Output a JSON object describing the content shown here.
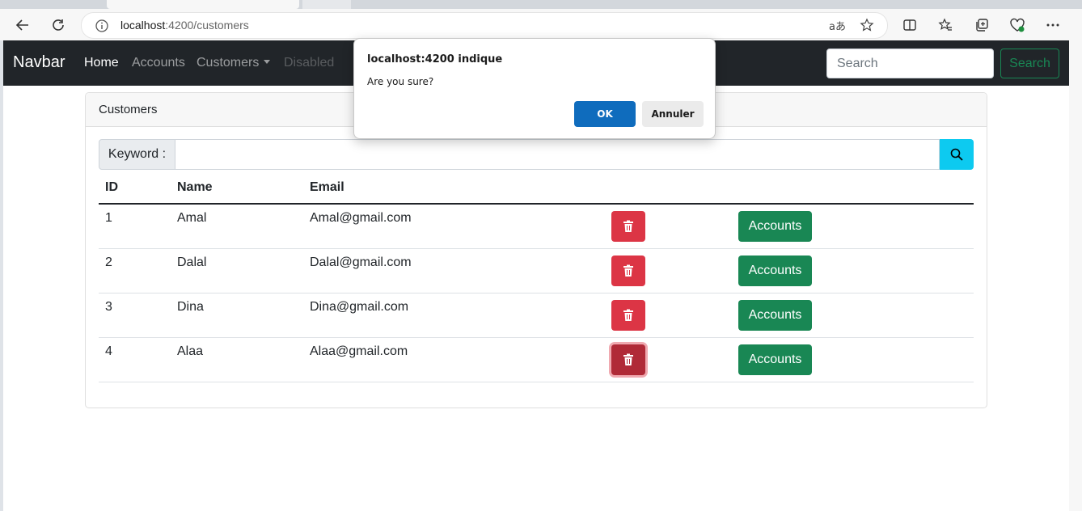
{
  "browser": {
    "url_host": "localhost",
    "url_path": ":4200/customers",
    "read_aloud_glyph": "aあ"
  },
  "navbar": {
    "brand": "Navbar",
    "links": [
      {
        "label": "Home",
        "state": "active"
      },
      {
        "label": "Accounts",
        "state": "normal"
      },
      {
        "label": "Customers",
        "state": "dropdown"
      },
      {
        "label": "Disabled",
        "state": "disabled"
      }
    ],
    "search_placeholder": "Search",
    "search_button": "Search"
  },
  "card": {
    "header": "Customers",
    "keyword_label": "Keyword :",
    "keyword_value": ""
  },
  "table": {
    "headers": [
      "ID",
      "Name",
      "Email"
    ],
    "rows": [
      {
        "id": "1",
        "name": "Amal",
        "email": "Amal@gmail.com",
        "accounts_label": "Accounts"
      },
      {
        "id": "2",
        "name": "Dalal",
        "email": "Dalal@gmail.com",
        "accounts_label": "Accounts"
      },
      {
        "id": "3",
        "name": "Dina",
        "email": "Dina@gmail.com",
        "accounts_label": "Accounts"
      },
      {
        "id": "4",
        "name": "Alaa",
        "email": "Alaa@gmail.com",
        "accounts_label": "Accounts"
      }
    ]
  },
  "dialog": {
    "title": "localhost:4200 indique",
    "message": "Are you sure?",
    "ok": "OK",
    "cancel": "Annuler"
  },
  "colors": {
    "navbar_bg": "#212529",
    "danger": "#dc3545",
    "success": "#198754",
    "info": "#0dcaf0",
    "dialog_primary": "#0f6cbd"
  }
}
